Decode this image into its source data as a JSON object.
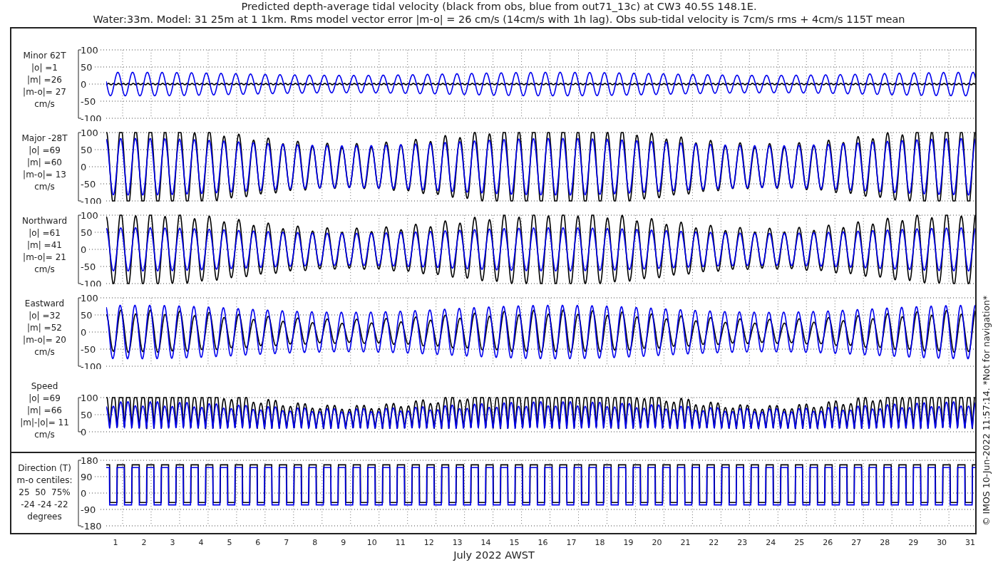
{
  "title": [
    "Predicted depth-average tidal velocity (black from obs, blue from out71_13c) at CW3 40.5S 148.1E.",
    "Water:33m. Model: 31 25m at 1 1km. Rms model vector error |m-o| = 26 cm/s (14cm/s with 1h lag). Obs sub-tidal velocity is 7cm/s rms + 4cm/s 115T mean"
  ],
  "panels": [
    {
      "kind": "velocity",
      "label": [
        "Minor 62T",
        "|o| =1",
        "|m| =26",
        "|m-o|= 27",
        "cm/s"
      ],
      "yticks": [
        "100",
        "50",
        "0",
        "-50",
        "-100"
      ]
    },
    {
      "kind": "velocity",
      "label": [
        "Major -28T",
        "|o| =69",
        "|m| =60",
        "|m-o|= 13",
        "cm/s"
      ],
      "yticks": [
        "100",
        "50",
        "0",
        "-50",
        "-100"
      ]
    },
    {
      "kind": "velocity",
      "label": [
        "Northward",
        "|o| =61",
        "|m| =41",
        "|m-o|= 21",
        "cm/s"
      ],
      "yticks": [
        "100",
        "50",
        "0",
        "-50",
        "-100"
      ]
    },
    {
      "kind": "velocity",
      "label": [
        "Eastward",
        "|o| =32",
        "|m| =52",
        "|m-o|= 20",
        "cm/s"
      ],
      "yticks": [
        "100",
        "50",
        "0",
        "-50",
        "-100"
      ]
    },
    {
      "kind": "speed",
      "label": [
        "Speed",
        "|o| =69",
        "|m| =66",
        "|m|-|o|= 11",
        "cm/s"
      ],
      "yticks": [
        "100",
        "50",
        "0"
      ]
    },
    {
      "kind": "direction",
      "label": [
        "Direction (T)",
        "m-o centiles:",
        "25  50  75%",
        "-24 -24 -22",
        "degrees"
      ],
      "yticks": [
        "180",
        "90",
        "0",
        "-90",
        "-180"
      ]
    }
  ],
  "xticks": [
    "1",
    "2",
    "3",
    "4",
    "5",
    "6",
    "7",
    "8",
    "9",
    "10",
    "11",
    "12",
    "13",
    "14",
    "15",
    "16",
    "17",
    "18",
    "19",
    "20",
    "21",
    "22",
    "23",
    "24",
    "25",
    "26",
    "27",
    "28",
    "29",
    "30",
    "31"
  ],
  "xlabel": "July 2022 AWST",
  "credit": "© IMOS 10-Jun-2022 11:57:14. *Not for navigation*"
}
